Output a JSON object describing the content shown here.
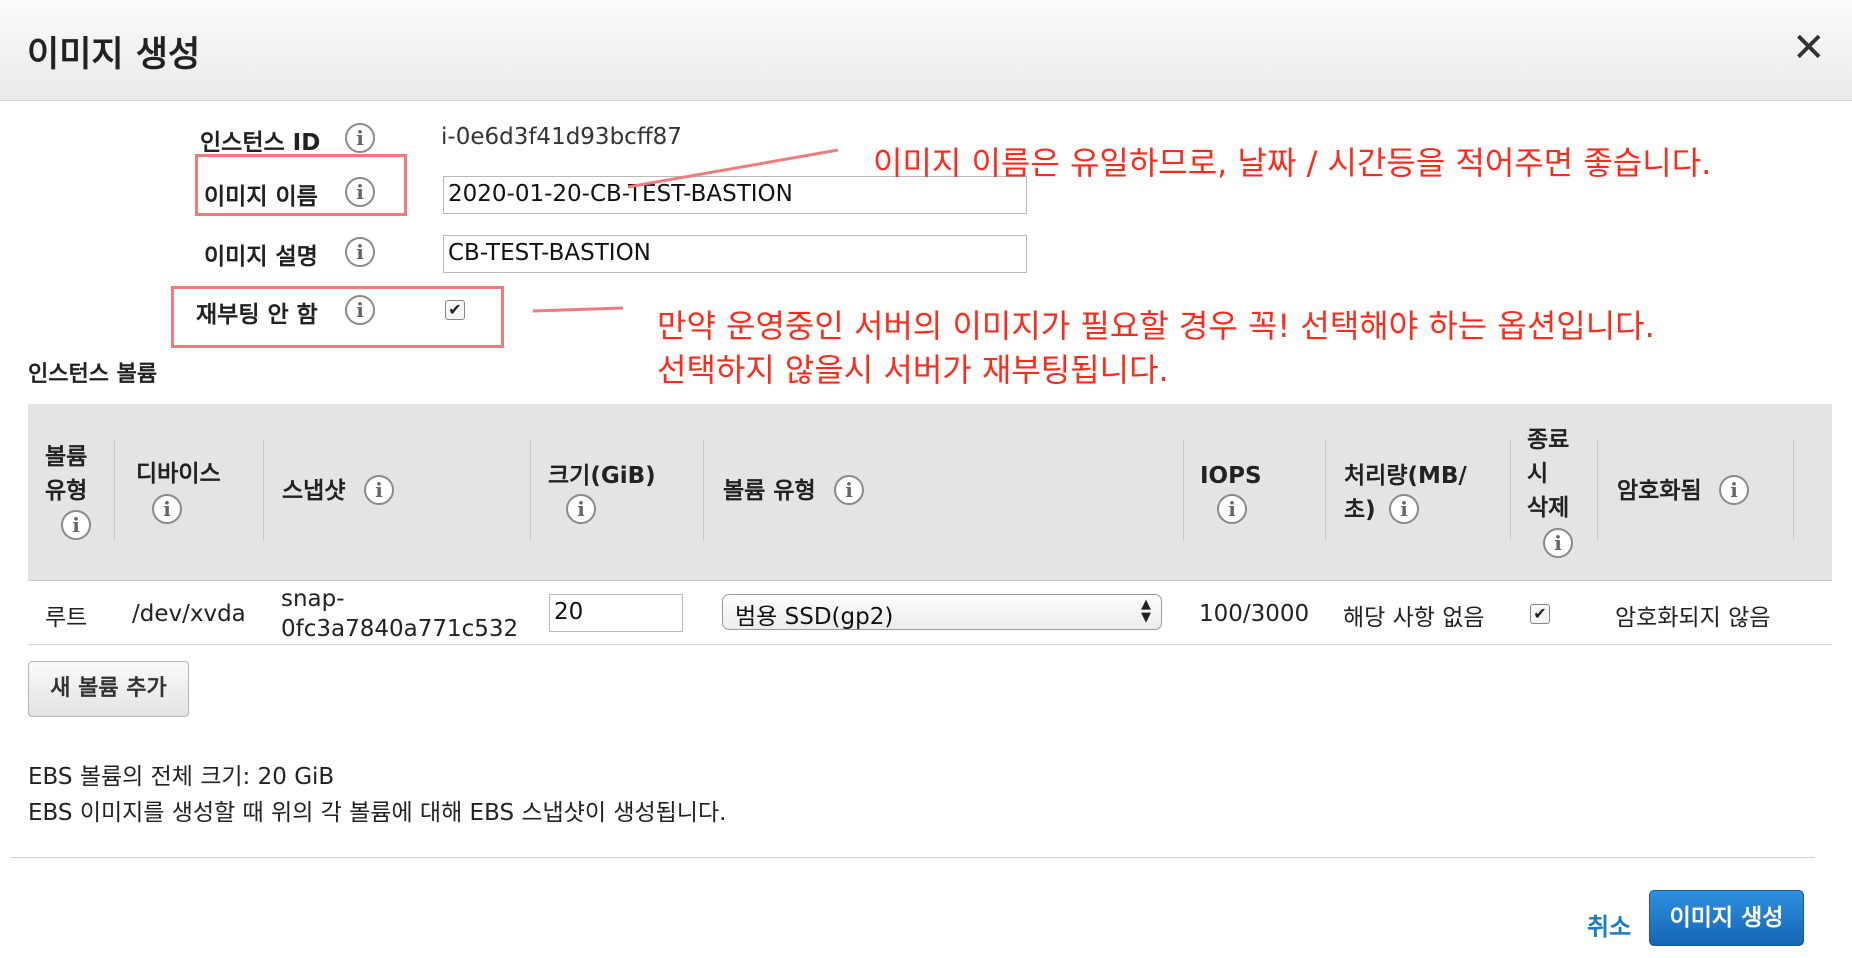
{
  "dialog": {
    "title": "이미지 생성",
    "close_glyph": "✕"
  },
  "form": {
    "instance_id_label": "인스턴스 ID",
    "instance_id_value": "i-0e6d3f41d93bcff87",
    "image_name_label": "이미지 이름",
    "image_name_value": "2020-01-20-CB-TEST-BASTION",
    "image_desc_label": "이미지 설명",
    "image_desc_value": "CB-TEST-BASTION",
    "no_reboot_label": "재부팅 안 함",
    "no_reboot_checked": true
  },
  "annotations": {
    "name_note": "이미지 이름은 유일하므로, 날짜 / 시간등을 적어주면 좋습니다.",
    "reboot_note_line1": "만약 운영중인 서버의 이미지가 필요할 경우 꼭! 선택해야 하는 옵션입니다.",
    "reboot_note_line2": "선택하지 않을시 서버가 재부팅됩니다.",
    "color": "#ff2a1a"
  },
  "volumes": {
    "section_title": "인스턴스 볼륨",
    "columns": {
      "volume_type_l1": "볼륨",
      "volume_type_l2": "유형",
      "device": "디바이스",
      "snapshot": "스냅샷",
      "size": "크기(GiB)",
      "ebs_type": "볼륨 유형",
      "iops": "IOPS",
      "throughput_l1": "처리량(MB/",
      "throughput_l2": "초)",
      "delete_l1": "종료",
      "delete_l2": "시",
      "delete_l3": "삭제",
      "encrypted": "암호화됨"
    },
    "row": {
      "volume_type": "루트",
      "device": "/dev/xvda",
      "snapshot_l1": "snap-",
      "snapshot_l2": "0fc3a7840a771c532",
      "size": "20",
      "ebs_type": "범용 SSD(gp2)",
      "iops": "100/3000",
      "throughput": "해당 사항 없음",
      "delete_on_termination": true,
      "encrypted": "암호화되지 않음"
    },
    "add_button": "새 볼륨 추가"
  },
  "footer": {
    "total_size": "EBS 볼륨의 전체 크기: 20 GiB",
    "note": "EBS 이미지를 생성할 때 위의 각 볼륨에 대해 EBS 스냅샷이 생성됩니다.",
    "cancel": "취소",
    "create": "이미지 생성"
  },
  "icons": {
    "info": "i",
    "check": "✔",
    "select_arrows": [
      "▲",
      "▼"
    ]
  },
  "colors": {
    "primary": "#1465b5",
    "link": "#1a7bc6",
    "annotation_box": "#f07b7b"
  }
}
